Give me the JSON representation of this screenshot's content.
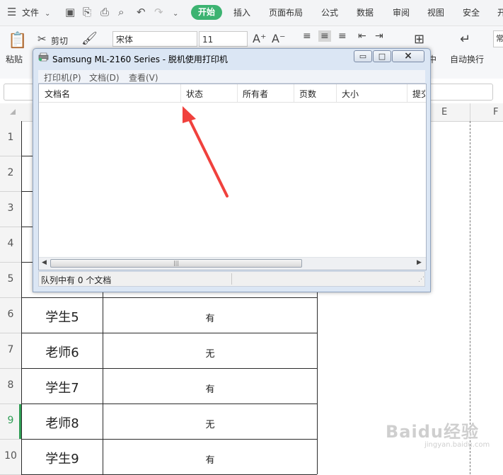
{
  "menubar": {
    "file_label": "文件",
    "tabs": [
      "开始",
      "插入",
      "页面布局",
      "公式",
      "数据",
      "审阅",
      "视图",
      "安全",
      "开"
    ]
  },
  "ribbon": {
    "paste_label": "粘贴",
    "cut_label": "剪切",
    "font_name": "宋体",
    "font_size": "11",
    "wrap_label": "自动换行",
    "merge_partial": "中",
    "partial_right": "常"
  },
  "grid": {
    "columns": [
      "E",
      "F"
    ],
    "rows": [
      {
        "num": "1",
        "a": "",
        "b": ""
      },
      {
        "num": "2",
        "a": "",
        "b": ""
      },
      {
        "num": "3",
        "a": "",
        "b": ""
      },
      {
        "num": "4",
        "a": "",
        "b": ""
      },
      {
        "num": "5",
        "a": "",
        "b": ""
      },
      {
        "num": "6",
        "a": "学生5",
        "b": "有"
      },
      {
        "num": "7",
        "a": "老师6",
        "b": "无"
      },
      {
        "num": "8",
        "a": "学生7",
        "b": "有"
      },
      {
        "num": "9",
        "a": "老师8",
        "b": "无"
      },
      {
        "num": "10",
        "a": "学生9",
        "b": "有"
      }
    ],
    "selected_row": "9"
  },
  "dialog": {
    "title": "Samsung ML-2160 Series  -  脱机使用打印机",
    "menus": [
      "打印机(P)",
      "文档(D)",
      "查看(V)"
    ],
    "columns": [
      "文档名",
      "状态",
      "所有者",
      "页数",
      "大小",
      "提交"
    ],
    "status": "队列中有 0 个文档",
    "minimize": "▭",
    "maximize": "□",
    "close": "×"
  },
  "watermark": {
    "text": "Baidu经验",
    "sub": "jingyan.baidu.com"
  },
  "colors": {
    "accent": "#3cb371",
    "arrow": "#f0413d",
    "dialog_frame": "#dbe6f4"
  }
}
